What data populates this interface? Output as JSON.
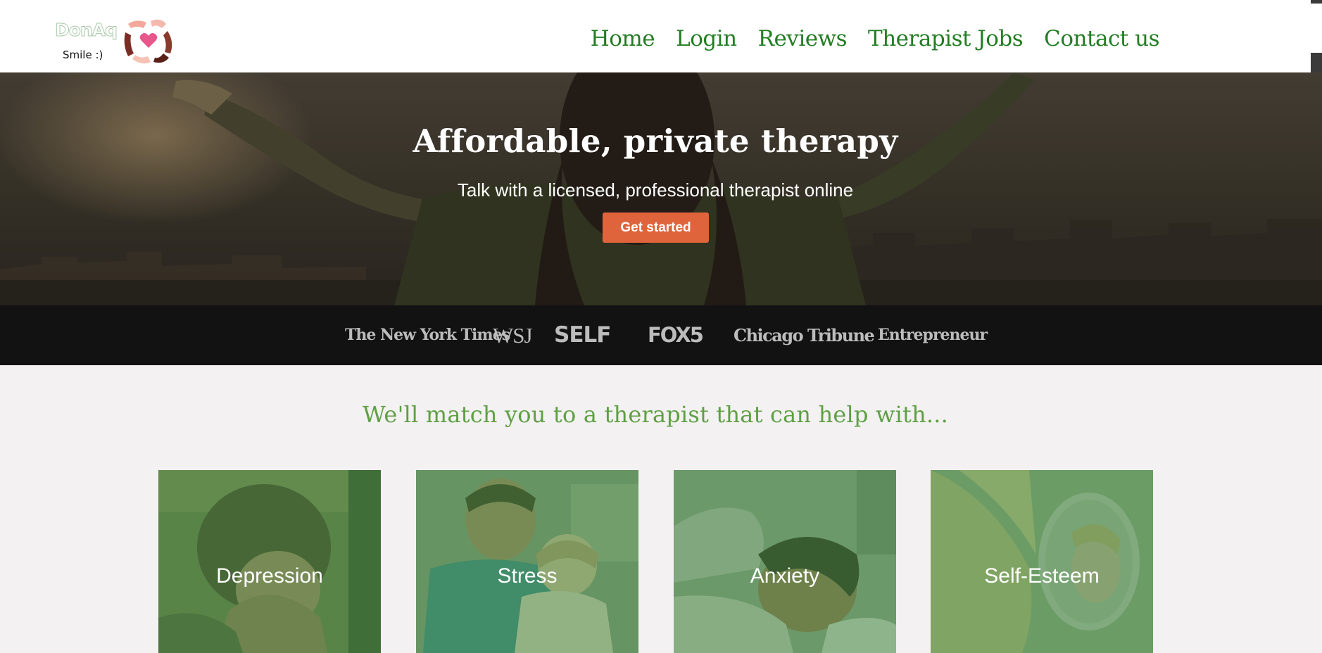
{
  "header": {
    "logo_text": "DonAq",
    "logo_tagline": "Smile :)",
    "nav": [
      {
        "label": "Home"
      },
      {
        "label": "Login"
      },
      {
        "label": "Reviews"
      },
      {
        "label": "Therapist Jobs"
      },
      {
        "label": "Contact us"
      }
    ]
  },
  "hero": {
    "title": "Affordable, private therapy",
    "subtitle": "Talk with a licensed, professional therapist online",
    "cta_label": "Get started"
  },
  "press": [
    "The New York Times",
    "WSJ",
    "SELF",
    "FOX5",
    "Chicago Tribune",
    "Entrepreneur"
  ],
  "match": {
    "heading": "We'll match you to a therapist that can help with...",
    "cards": [
      {
        "label": "Depression"
      },
      {
        "label": "Stress"
      },
      {
        "label": "Anxiety"
      },
      {
        "label": "Self-Esteem"
      }
    ]
  },
  "colors": {
    "nav_link": "#237d23",
    "cta": "#e0643b",
    "press_bar": "#121212",
    "match_heading": "#5fa045",
    "card_tint": "#468c46"
  }
}
